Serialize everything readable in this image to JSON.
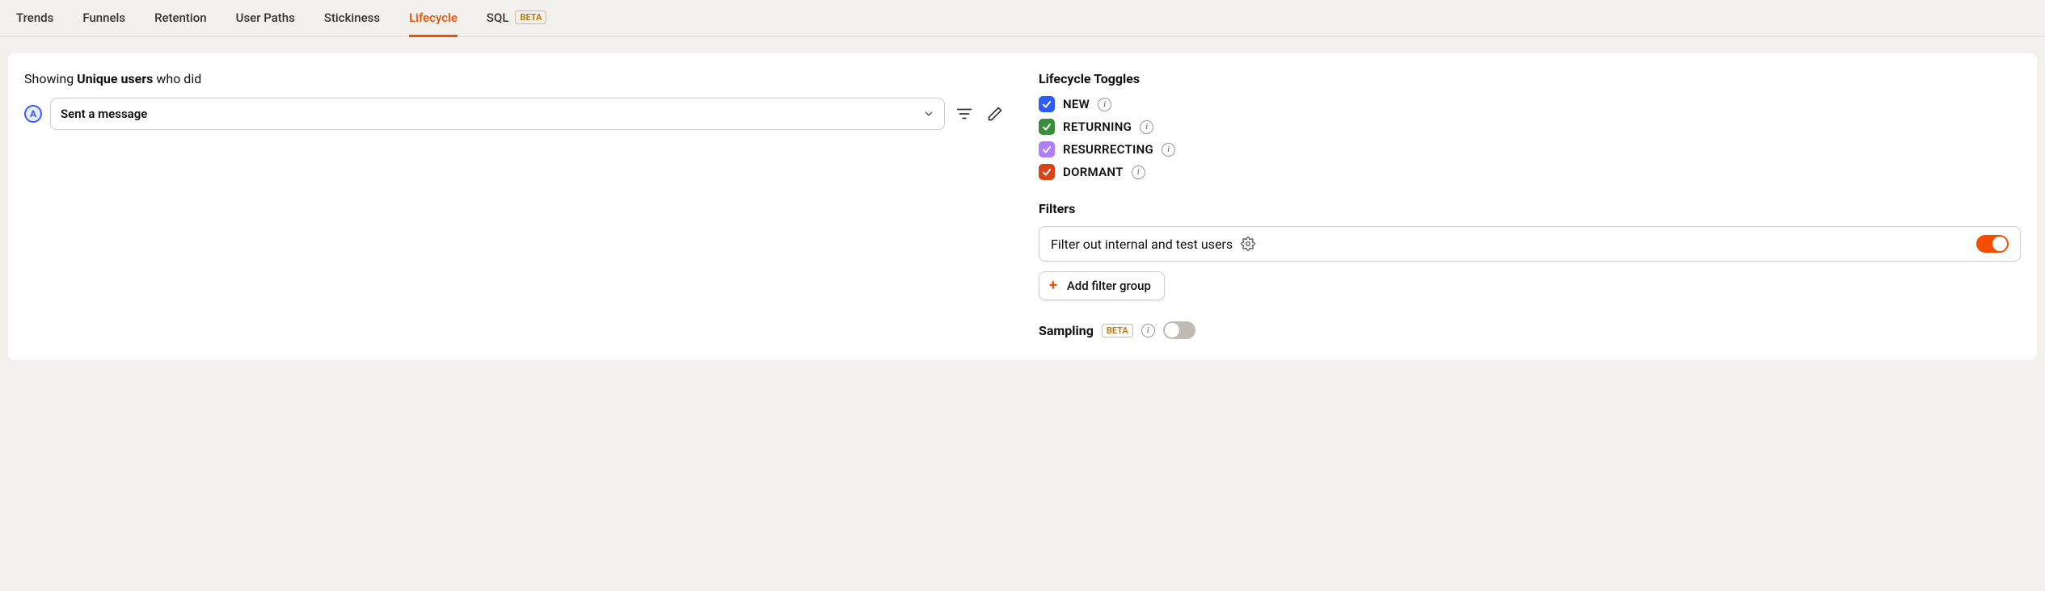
{
  "tabs": [
    {
      "label": "Trends",
      "active": false
    },
    {
      "label": "Funnels",
      "active": false
    },
    {
      "label": "Retention",
      "active": false
    },
    {
      "label": "User Paths",
      "active": false
    },
    {
      "label": "Stickiness",
      "active": false
    },
    {
      "label": "Lifecycle",
      "active": true
    },
    {
      "label": "SQL",
      "active": false,
      "badge": "BETA"
    }
  ],
  "intro": {
    "prefix": "Showing ",
    "strong": "Unique users",
    "suffix": " who did"
  },
  "series": {
    "letter": "A",
    "event_label": "Sent a message"
  },
  "lifecycle": {
    "title": "Lifecycle Toggles",
    "items": [
      {
        "label": "NEW",
        "color": "#2a5cff",
        "checked": true
      },
      {
        "label": "RETURNING",
        "color": "#388e3c",
        "checked": true
      },
      {
        "label": "RESURRECTING",
        "color": "#b07dff",
        "checked": true
      },
      {
        "label": "DORMANT",
        "color": "#d84315",
        "checked": true
      }
    ]
  },
  "filters": {
    "title": "Filters",
    "internal_test_label": "Filter out internal and test users",
    "internal_test_enabled": true,
    "add_group_label": "Add filter group"
  },
  "sampling": {
    "title": "Sampling",
    "badge": "BETA",
    "enabled": false
  }
}
